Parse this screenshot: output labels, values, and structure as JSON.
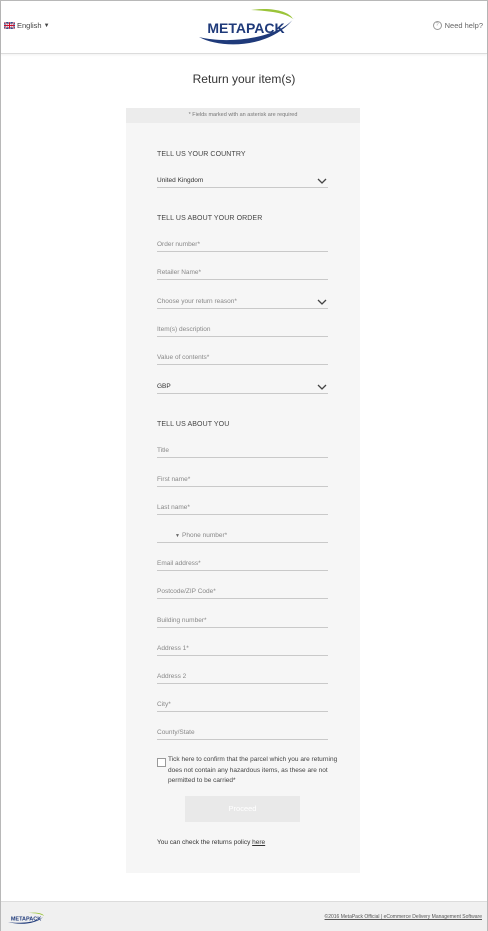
{
  "header": {
    "language": "English",
    "logo_text": "METAPACK",
    "help": "Need help?"
  },
  "title": "Return your item(s)",
  "form": {
    "required_note": "* Fields marked with an asterisk are required",
    "country_heading": "TELL US YOUR COUNTRY",
    "country_value": "United Kingdom",
    "order_heading": "TELL US ABOUT YOUR ORDER",
    "order_number": "Order number*",
    "retailer_name": "Retailer Name*",
    "return_reason": "Choose your return reason*",
    "item_description": "Item(s) description",
    "value_of_contents": "Value of contents*",
    "currency_value": "GBP",
    "about_heading": "TELL US ABOUT YOU",
    "title_field": "Title",
    "first_name": "First name*",
    "last_name": "Last name*",
    "phone_number": "Phone number*",
    "email": "Email address*",
    "postcode": "Postcode/ZIP Code*",
    "building_number": "Building number*",
    "address1": "Address 1*",
    "address2": "Address 2",
    "city": "City*",
    "county": "County/State",
    "hazard_text": "Tick here to confirm that the parcel which you are returning does not contain any hazardous items, as these are not permitted to be carried*",
    "proceed": "Proceed",
    "policy_prefix": "You can check the returns policy ",
    "policy_link": "here"
  },
  "footer": {
    "logo_text": "METAPACK",
    "copyright": "©2016 MetaPack Official | eCommerce Delivery Management Software"
  },
  "colors": {
    "brand_navy": "#1f3a7a",
    "brand_green": "#9bc43a"
  }
}
